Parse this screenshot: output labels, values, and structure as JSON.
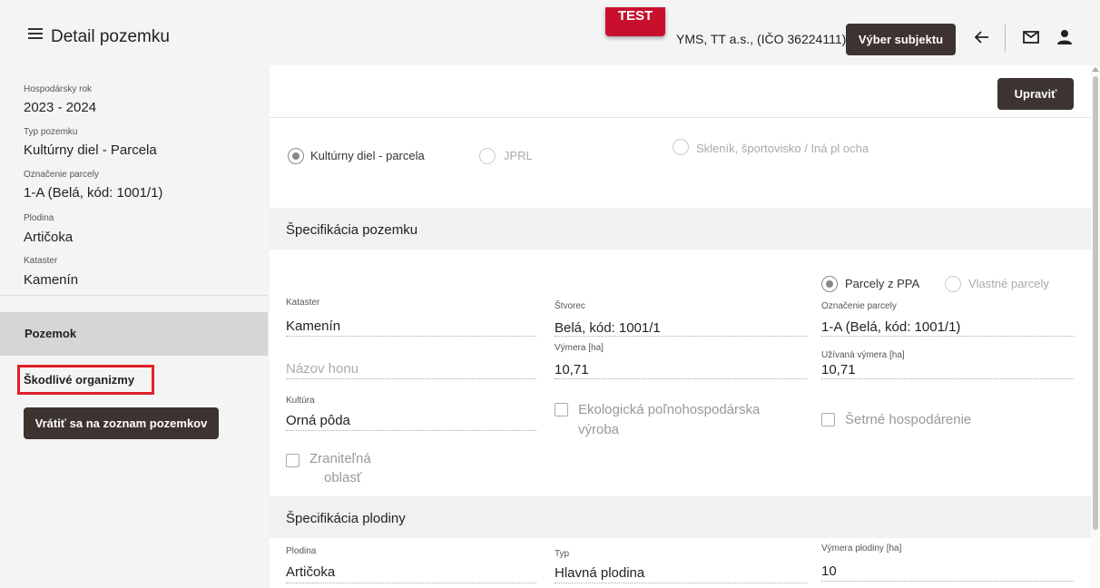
{
  "header": {
    "title": "Detail pozemku",
    "test_badge": "TEST",
    "subject": "YMS, TT a.s., (IČO 36224111)",
    "select_subject_label": "Výber subjektu"
  },
  "sidebar": {
    "info": [
      {
        "label": "Hospodársky rok",
        "value": "2023 - 2024"
      },
      {
        "label": "Typ pozemku",
        "value": "Kultúrny diel - Parcela"
      },
      {
        "label": "Označenie parcely",
        "value": "1-A (Belá, kód: 1001/1)"
      },
      {
        "label": "Plodina",
        "value": "Artičoka"
      },
      {
        "label": "Kataster",
        "value": "Kamenín"
      }
    ],
    "nav": {
      "plot": "Pozemok",
      "harmful": "Škodlivé organizmy"
    },
    "return_label": "Vrátiť sa na zoznam pozemkov"
  },
  "main": {
    "edit_label": "Upraviť",
    "type_options": [
      "Kultúrny diel - parcela",
      "JPRL",
      "Skleník, športovisko / Iná pl ocha"
    ],
    "section_plot": "Špecifikácia pozemku",
    "parcel_options": [
      "Parcely z PPA",
      "Vlastné parcely"
    ],
    "fields": {
      "kataster_label": "Kataster",
      "kataster_value": "Kamenín",
      "stvorec_label": "Štvorec",
      "stvorec_value": "Belá, kód: 1001/1",
      "oznacenie_label": "Označenie parcely",
      "oznacenie_value": "1-A (Belá, kód: 1001/1)",
      "nazov_placeholder": "Názov honu",
      "vymera_label": "Výmera [ha]",
      "vymera_value": "10,71",
      "uzivana_label": "Užívaná výmera [ha]",
      "uzivana_value": "10,71",
      "kultura_label": "Kultúra",
      "kultura_value": "Orná pôda"
    },
    "checkboxes": {
      "eko_line1": "Ekologická poľnohospodárska",
      "eko_line2": "výroba",
      "setrne": "Šetrné hospodárenie",
      "zranitelna_line1": "Zraniteľná",
      "zranitelna_line2": "oblasť"
    },
    "section_crop": "Špecifikácia plodiny",
    "crop": {
      "plodina_label": "Plodina",
      "plodina_value": "Artičoka",
      "typ_label": "Typ",
      "typ_value": "Hlavná plodina",
      "vymera_label": "Výmera plodiny [ha]",
      "vymera_value": "10"
    }
  }
}
